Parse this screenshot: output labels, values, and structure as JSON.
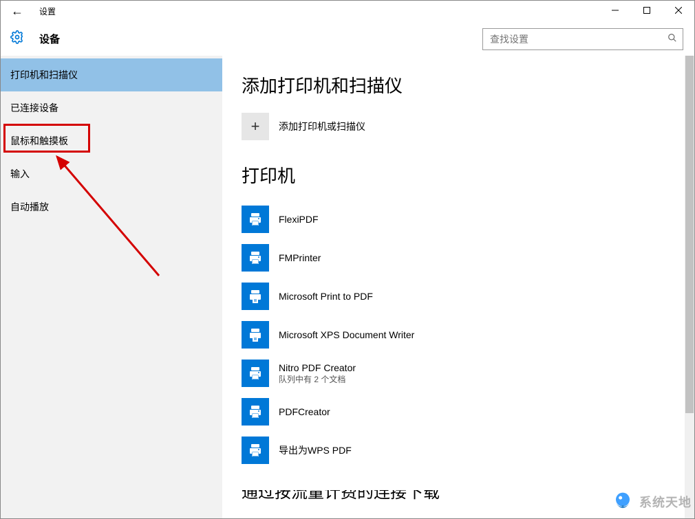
{
  "titlebar": {
    "title": "设置"
  },
  "header": {
    "title": "设备",
    "search_placeholder": "查找设置"
  },
  "sidebar": {
    "items": [
      {
        "label": "打印机和扫描仪"
      },
      {
        "label": "已连接设备"
      },
      {
        "label": "鼠标和触摸板"
      },
      {
        "label": "输入"
      },
      {
        "label": "自动播放"
      }
    ]
  },
  "main": {
    "section1_title": "添加打印机和扫描仪",
    "add_label": "添加打印机或扫描仪",
    "section2_title": "打印机",
    "printers": [
      {
        "name": "FlexiPDF",
        "sub": "",
        "type": "printer"
      },
      {
        "name": "FMPrinter",
        "sub": "",
        "type": "printer"
      },
      {
        "name": "Microsoft Print to PDF",
        "sub": "",
        "type": "doc"
      },
      {
        "name": "Microsoft XPS Document Writer",
        "sub": "",
        "type": "doc"
      },
      {
        "name": "Nitro PDF Creator",
        "sub": "队列中有 2 个文档",
        "type": "printer"
      },
      {
        "name": "PDFCreator",
        "sub": "",
        "type": "printer"
      },
      {
        "name": "导出为WPS PDF",
        "sub": "",
        "type": "printer"
      }
    ],
    "cutoff": "通过按流量计费的连接下载"
  },
  "watermark": {
    "text": "系统天地"
  }
}
